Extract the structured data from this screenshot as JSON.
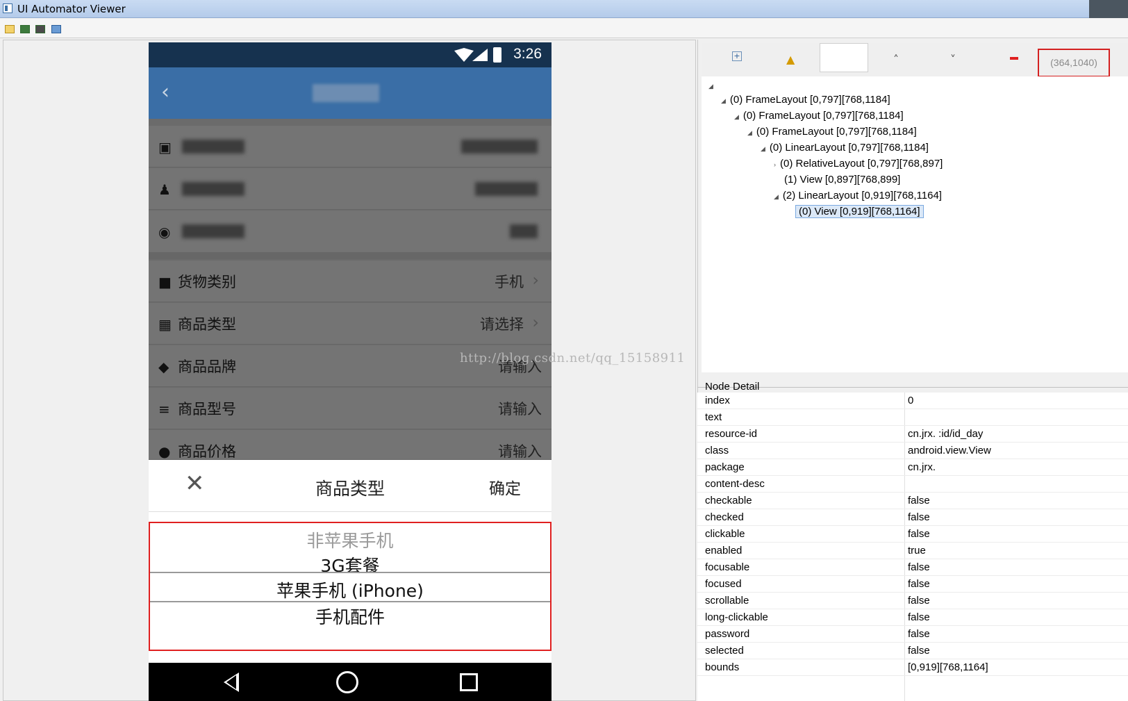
{
  "window": {
    "title": "UI Automator Viewer"
  },
  "device": {
    "status_time": "3:26",
    "picker": {
      "title": "商品类型",
      "confirm": "确定",
      "options": [
        "非苹果手机",
        "3G套餐",
        "苹果手机 (iPhone)",
        "手机配件"
      ]
    },
    "form_rows": [
      {
        "label": "货物类别",
        "value": "手机"
      },
      {
        "label": "商品类型",
        "value": "请选择"
      },
      {
        "label": "商品品牌",
        "value": "请输入"
      },
      {
        "label": "商品型号",
        "value": "请输入"
      },
      {
        "label": "商品价格",
        "value": "请输入"
      }
    ]
  },
  "watermark": "http://blog.csdn.net/qq_15158911",
  "coordinates": "(364,1040)",
  "tree": [
    {
      "text": "(0) FrameLayout [0,797][768,1184]"
    },
    {
      "text": "(0) FrameLayout [0,797][768,1184]"
    },
    {
      "text": "(0) FrameLayout [0,797][768,1184]"
    },
    {
      "text": "(0) LinearLayout [0,797][768,1184]"
    },
    {
      "text": "(0) RelativeLayout [0,797][768,897]"
    },
    {
      "text": "(1) View [0,897][768,899]"
    },
    {
      "text": "(2) LinearLayout [0,919][768,1164]"
    },
    {
      "text": "(0) View [0,919][768,1164]"
    }
  ],
  "node_detail": {
    "title": "Node Detail",
    "rows": [
      {
        "key": "index",
        "value": "0"
      },
      {
        "key": "text",
        "value": ""
      },
      {
        "key": "resource-id",
        "value": "cn.jrx.      :id/id_day"
      },
      {
        "key": "class",
        "value": "android.view.View"
      },
      {
        "key": "package",
        "value": "cn.jrx."
      },
      {
        "key": "content-desc",
        "value": ""
      },
      {
        "key": "checkable",
        "value": "false"
      },
      {
        "key": "checked",
        "value": "false"
      },
      {
        "key": "clickable",
        "value": "false"
      },
      {
        "key": "enabled",
        "value": "true"
      },
      {
        "key": "focusable",
        "value": "false"
      },
      {
        "key": "focused",
        "value": "false"
      },
      {
        "key": "scrollable",
        "value": "false"
      },
      {
        "key": "long-clickable",
        "value": "false"
      },
      {
        "key": "password",
        "value": "false"
      },
      {
        "key": "selected",
        "value": "false"
      },
      {
        "key": "bounds",
        "value": "[0,919][768,1164]"
      }
    ]
  },
  "icons": {
    "open": "folder-open-icon",
    "device_screenshot": "device-screenshot-icon",
    "device_screenshot_compressed": "device-screenshot-compressed-icon",
    "save": "save-icon",
    "expand_all": "expand-all-icon",
    "warning": "warning-icon",
    "prev": "chevron-up-icon",
    "next": "chevron-down-icon",
    "clear": "remove-icon"
  }
}
